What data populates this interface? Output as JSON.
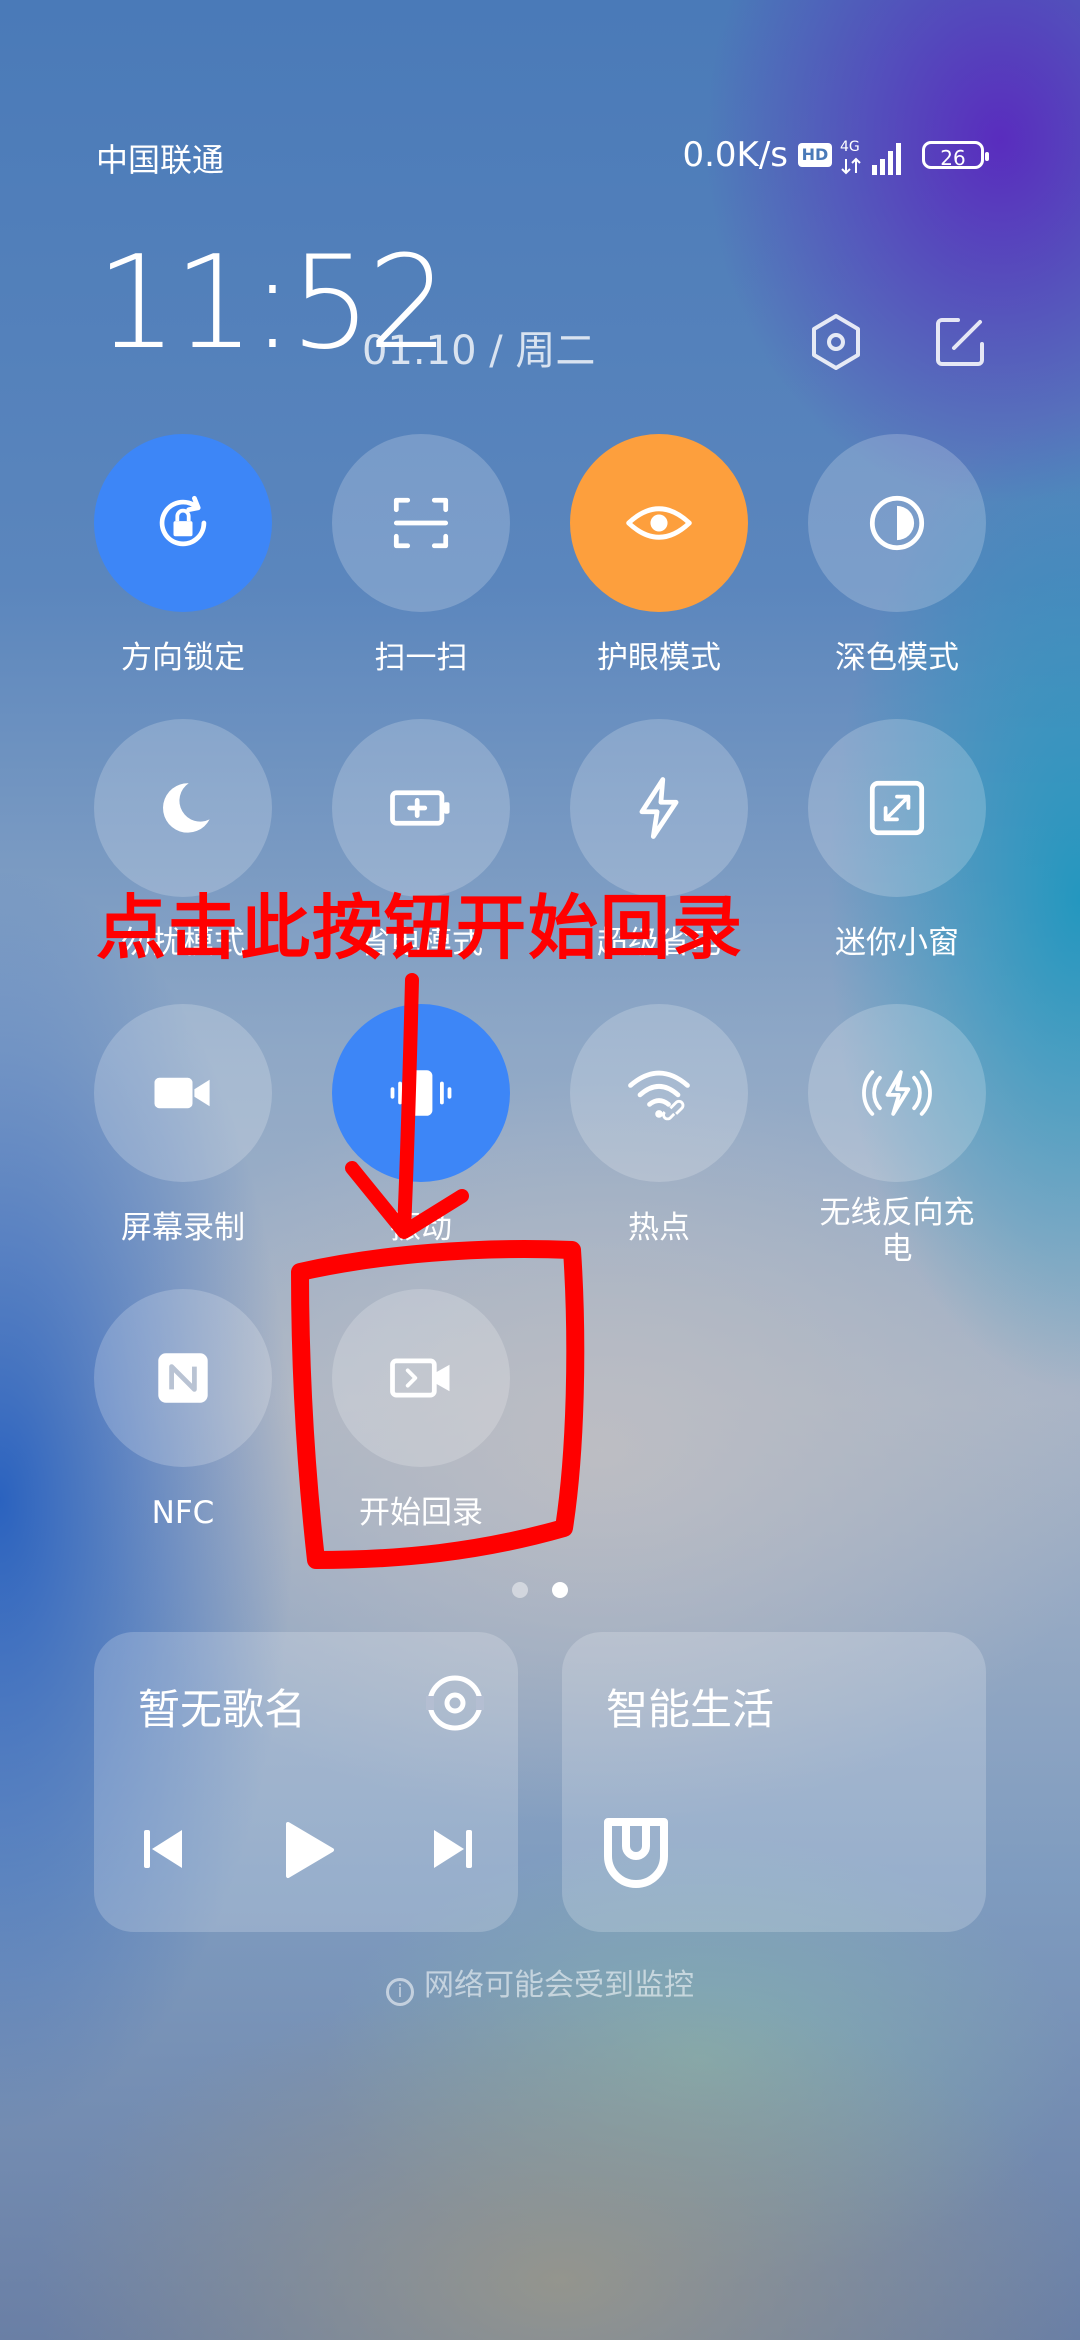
{
  "status_bar": {
    "carrier": "中国联通",
    "net_speed": "0.0K/s",
    "hd_badge": "HD",
    "network": "4G",
    "battery": "26"
  },
  "header": {
    "time": "11:52",
    "date": "01.10 / 周二",
    "icons": [
      "settings-icon",
      "edit-icon"
    ]
  },
  "tiles": [
    {
      "label": "方向锁定",
      "icon": "rotation-lock-icon",
      "state": "on",
      "color": "#3d86f7"
    },
    {
      "label": "扫一扫",
      "icon": "scan-icon",
      "state": "off"
    },
    {
      "label": "护眼模式",
      "icon": "eye-icon",
      "state": "on",
      "color": "#fd9f3d"
    },
    {
      "label": "深色模式",
      "icon": "dark-mode-icon",
      "state": "off"
    },
    {
      "label": "勿扰模式",
      "icon": "moon-icon",
      "state": "off"
    },
    {
      "label": "省电模式",
      "icon": "battery-saver-icon",
      "state": "off"
    },
    {
      "label": "超级省电",
      "icon": "bolt-icon",
      "state": "off"
    },
    {
      "label": "迷你小窗",
      "icon": "mini-window-icon",
      "state": "off"
    },
    {
      "label": "屏幕录制",
      "icon": "video-camera-icon",
      "state": "off"
    },
    {
      "label": "振动",
      "icon": "vibrate-icon",
      "state": "on",
      "color": "#3d86f7"
    },
    {
      "label": "热点",
      "icon": "hotspot-icon",
      "state": "off"
    },
    {
      "label": "无线反向充电",
      "icon": "reverse-charge-icon",
      "state": "off"
    },
    {
      "label": "NFC",
      "icon": "nfc-icon",
      "state": "off"
    },
    {
      "label": "开始回录",
      "icon": "replay-record-icon",
      "state": "off"
    }
  ],
  "page_indicator": {
    "pages": 2,
    "current": 2
  },
  "media_card": {
    "title": "暂无歌名"
  },
  "smart_card": {
    "title": "智能生活"
  },
  "warning": "网络可能会受到监控",
  "annotation": {
    "text": "点击此按钮开始回录",
    "color": "#ff0000"
  }
}
